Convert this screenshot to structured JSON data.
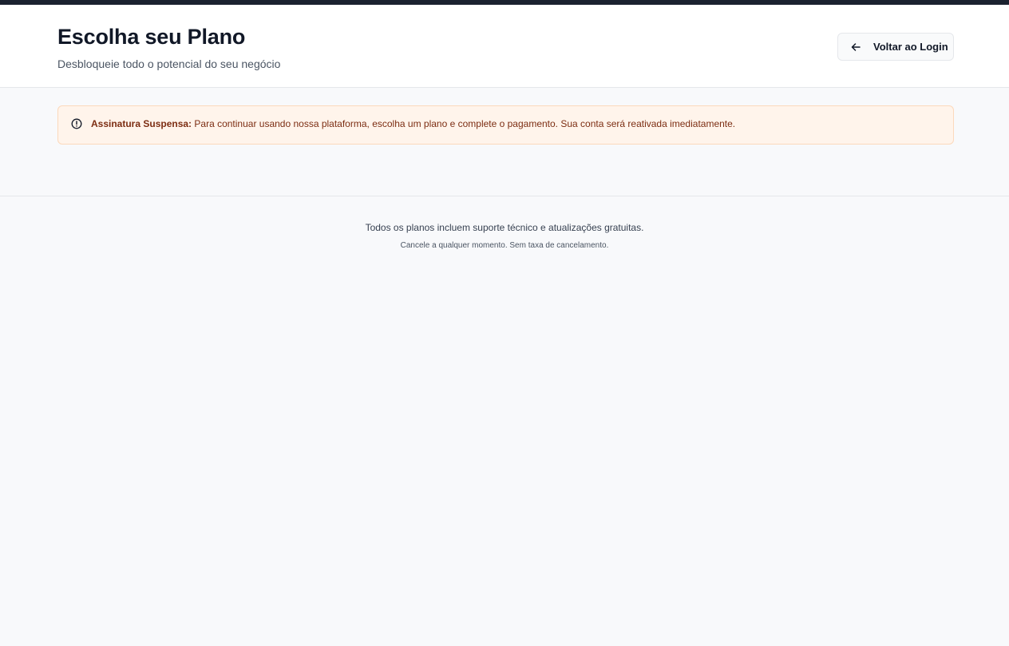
{
  "header": {
    "title": "Escolha seu Plano",
    "subtitle": "Desbloqueie todo o potencial do seu negócio",
    "back_button": {
      "label": "Voltar ao Login",
      "icon": "arrow-left-icon"
    }
  },
  "alert": {
    "icon": "alert-circle-icon",
    "title": "Assinatura Suspensa:",
    "message": "Para continuar usando nossa plataforma, escolha um plano e complete o pagamento. Sua conta será reativada imediatamente."
  },
  "footer": {
    "line1": "Todos os planos incluem suporte técnico e atualizações gratuitas.",
    "line2": "Cancele a qualquer momento. Sem taxa de cancelamento."
  },
  "colors": {
    "top_bar": "#1b2230",
    "alert_background": "#fff4eb",
    "alert_border": "#fcd9bc",
    "alert_text": "#7c2d12",
    "page_background": "#f8f9fb"
  }
}
